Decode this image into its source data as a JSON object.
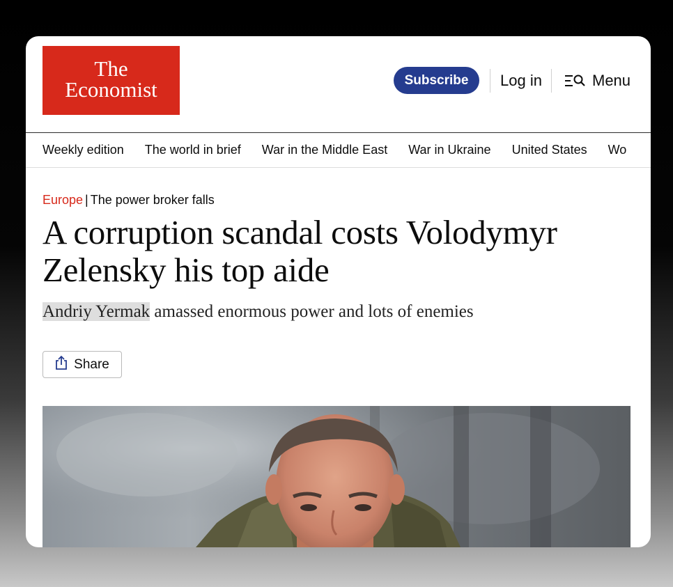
{
  "logo": {
    "line1": "The",
    "line2": "Economist",
    "color": "#d7291b"
  },
  "header": {
    "subscribe_label": "Subscribe",
    "login_label": "Log in",
    "menu_label": "Menu",
    "menu_icon": "search-menu-icon",
    "subscribe_color": "#253c8f"
  },
  "nav": {
    "items": [
      "Weekly edition",
      "The world in brief",
      "War in the Middle East",
      "War in Ukraine",
      "United States",
      "Wo"
    ]
  },
  "article": {
    "section": "Europe",
    "separator": "|",
    "fly_title": "The power broker falls",
    "headline": "A corruption scandal costs Volodymyr Zelensky his top aide",
    "standfirst_highlight": "Andriy Yermak",
    "standfirst_rest": " amassed enormous power and lots of enemies",
    "share_label": "Share",
    "share_icon": "share-icon",
    "image_subject": "photo"
  }
}
